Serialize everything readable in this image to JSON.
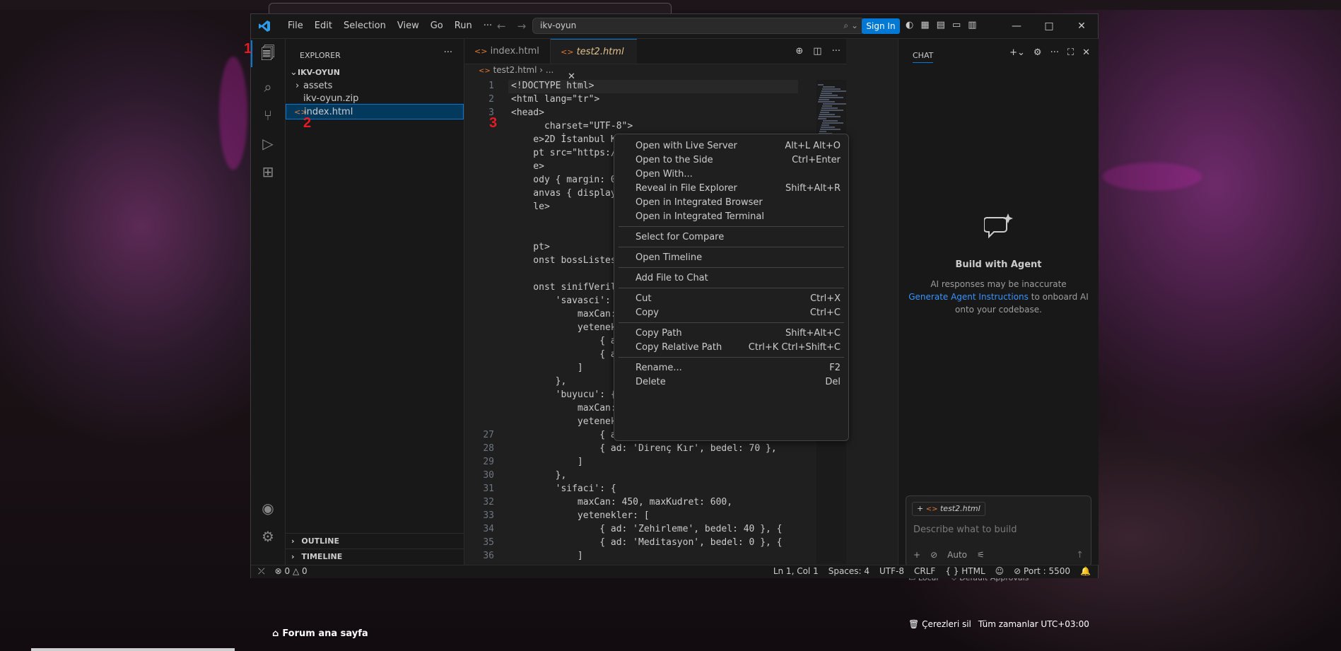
{
  "vscode": {
    "menu": [
      "File",
      "Edit",
      "Selection",
      "View",
      "Go",
      "Run",
      "···"
    ],
    "command_center": "ikv-oyun",
    "sign_in": "Sign In",
    "explorer": {
      "header": "EXPLORER",
      "root": "IKV-OYUN",
      "items": [
        "assets",
        "ikv-oyun.zip",
        "index.html"
      ],
      "outline": "OUTLINE",
      "timeline": "TIMELINE"
    },
    "tabs": [
      "index.html",
      "test2.html"
    ],
    "breadcrumb": [
      "test2.html",
      "..."
    ],
    "code": [
      {
        "n": "1",
        "t": "<!DOCTYPE html>"
      },
      {
        "n": "2",
        "t": "<html lang=\"tr\">"
      },
      {
        "n": "3",
        "t": "<head>"
      },
      {
        "n": "",
        "t": "      charset=\"UTF-8\">"
      },
      {
        "n": "",
        "t": "    e>2D İstanbul Kıyamet Vakti - Nano Pro VFX S"
      },
      {
        "n": "",
        "t": "    pt src=\"https://cdn.jsdelivr.net/npm/phaser@"
      },
      {
        "n": "",
        "t": "    e>"
      },
      {
        "n": "",
        "t": "    ody { margin: 0; background-color: □#000; o"
      },
      {
        "n": "",
        "t": "    anvas { display: block; }"
      },
      {
        "n": "",
        "t": "    le>"
      },
      {
        "n": "",
        "t": ""
      },
      {
        "n": "",
        "t": ""
      },
      {
        "n": "",
        "t": "    pt>"
      },
      {
        "n": "",
        "t": "    onst bossListesi = ['azul', 'kizginkum', 'ku"
      },
      {
        "n": "",
        "t": ""
      },
      {
        "n": "",
        "t": "    onst sinifVerileri = {"
      },
      {
        "n": "",
        "t": "        'savasci': {"
      },
      {
        "n": "",
        "t": "            maxCan: 800, maxKudret: 200,"
      },
      {
        "n": "",
        "t": "            yetenekler: ["
      },
      {
        "n": "",
        "t": "                { ad: 'Depar', bedel: 30 }, { ad:"
      },
      {
        "n": "",
        "t": "                { ad: 'Durdurma', bedel: 60 }, {"
      },
      {
        "n": "",
        "t": "            ]"
      },
      {
        "n": "",
        "t": "        },"
      },
      {
        "n": "",
        "t": "        'buyucu': {"
      },
      {
        "n": "",
        "t": "            maxCan: 300, maxKudret: 900,"
      },
      {
        "n": "",
        "t": "            yetenekler: ["
      },
      {
        "n": "27",
        "t": "                { ad: 'Meteorit', bedel: 50 }, {"
      },
      {
        "n": "28",
        "t": "                { ad: 'Direnç Kır', bedel: 70 },"
      },
      {
        "n": "29",
        "t": "            ]"
      },
      {
        "n": "30",
        "t": "        },"
      },
      {
        "n": "31",
        "t": "        'sifaci': {"
      },
      {
        "n": "32",
        "t": "            maxCan: 450, maxKudret: 600,"
      },
      {
        "n": "33",
        "t": "            yetenekler: ["
      },
      {
        "n": "34",
        "t": "                { ad: 'Zehirleme', bedel: 40 }, {"
      },
      {
        "n": "35",
        "t": "                { ad: 'Meditasyon', bedel: 0 }, {"
      },
      {
        "n": "36",
        "t": "            ]"
      }
    ],
    "chat": {
      "header": "CHAT",
      "title": "Build with Agent",
      "note1": "AI responses may be inaccurate",
      "note_link": "Generate Agent Instructions",
      "note2": "to onboard AI",
      "note3": "onto your codebase.",
      "attachment": "test2.html",
      "placeholder": "Describe what to build",
      "mode": "Auto",
      "footer_local": "Local",
      "footer_approvals": "Default Approvals"
    },
    "status": {
      "problems": "0",
      "warnings": "0",
      "position": "Ln 1, Col 1",
      "spaces": "Spaces: 4",
      "encoding": "UTF-8",
      "eol": "CRLF",
      "language": "HTML",
      "port": "Port : 5500"
    }
  },
  "context_menu": [
    {
      "label": "Open with Live Server",
      "key": "Alt+L Alt+O"
    },
    {
      "label": "Open to the Side",
      "key": "Ctrl+Enter"
    },
    {
      "label": "Open With...",
      "key": ""
    },
    {
      "label": "Reveal in File Explorer",
      "key": "Shift+Alt+R"
    },
    {
      "label": "Open in Integrated Browser",
      "key": ""
    },
    {
      "label": "Open in Integrated Terminal",
      "key": ""
    },
    {
      "label": "Select for Compare",
      "key": ""
    },
    {
      "label": "Open Timeline",
      "key": ""
    },
    {
      "label": "Add File to Chat",
      "key": ""
    },
    {
      "label": "Cut",
      "key": "Ctrl+X"
    },
    {
      "label": "Copy",
      "key": "Ctrl+C"
    },
    {
      "label": "Copy Path",
      "key": "Shift+Alt+C"
    },
    {
      "label": "Copy Relative Path",
      "key": "Ctrl+K Ctrl+Shift+C"
    },
    {
      "label": "Rename...",
      "key": "F2"
    },
    {
      "label": "Delete",
      "key": "Del"
    }
  ],
  "annotations": [
    "1",
    "2",
    "3"
  ],
  "page": {
    "forum_link": "Forum ana sayfa",
    "cookies": "Çerezleri sil",
    "timezone": "Tüm zamanlar UTC+03:00"
  },
  "colors": {
    "accent": "#0078d4",
    "annotation": "#e51c23",
    "tab_modified": "#e2c08d"
  }
}
